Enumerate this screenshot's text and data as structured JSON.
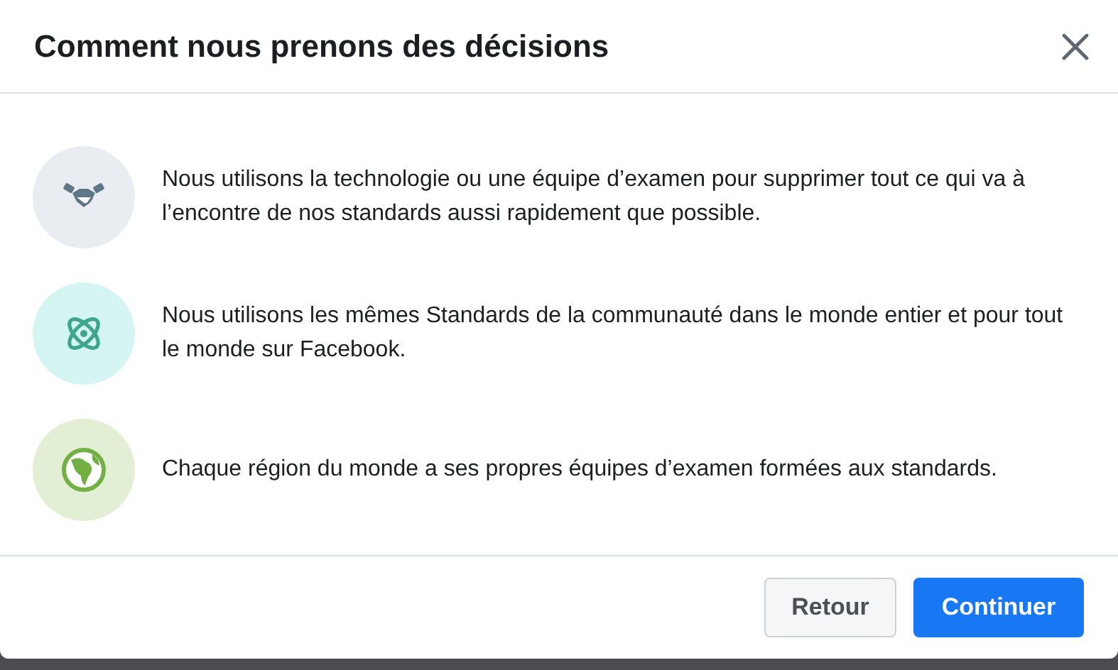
{
  "dialog": {
    "title": "Comment nous prenons des décisions"
  },
  "items": [
    {
      "kind": "handshake",
      "color": "#e9edf1",
      "text": "Nous utilisons la technologie ou une équipe d’examen pour supprimer tout ce qui va à l’encontre de nos standards aussi rapidement que possible."
    },
    {
      "kind": "atom",
      "color": "#d4f5f1",
      "text": "Nous utilisons les mêmes Standards de la communauté dans le monde entier et pour tout le monde sur Facebook."
    },
    {
      "kind": "globe",
      "color": "#e2efd5",
      "text": "Chaque région du monde a ses propres équipes d’examen formées aux standards."
    }
  ],
  "buttons": [
    {
      "label": "Retour",
      "kind": "secondary"
    },
    {
      "label": "Continuer",
      "kind": "primary"
    }
  ]
}
